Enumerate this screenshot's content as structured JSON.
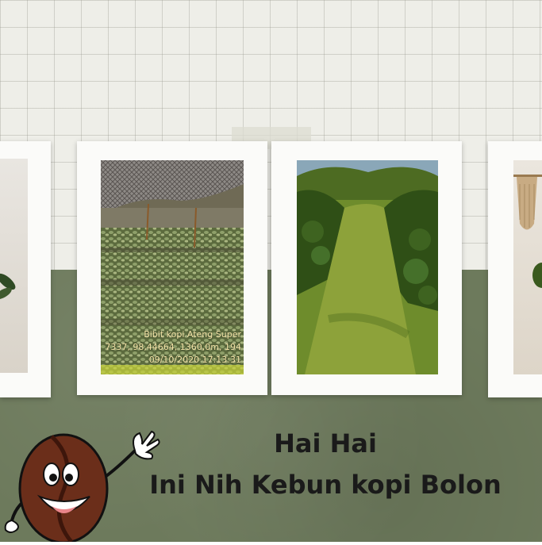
{
  "photos": {
    "left_partial": {
      "alt": "plant decor photo"
    },
    "seedlings": {
      "caption_line1": "Bibit kopi Ateng Super",
      "caption_line2": "7337, 98,44664, 1360,0m, 194",
      "caption_line3": "09/10/2020 17:13:31"
    },
    "garden": {},
    "right_partial": {}
  },
  "headline": {
    "line1": "Hai Hai",
    "line2": "Ini Nih Kebun kopi Bolon"
  },
  "colors": {
    "wall_top": "#eeeee8",
    "wall_bottom": "#6d7a5c",
    "frame": "#fbfbf9",
    "bean": "#6b2e1a"
  },
  "icons": [
    "coffee-bean-mascot-icon"
  ]
}
